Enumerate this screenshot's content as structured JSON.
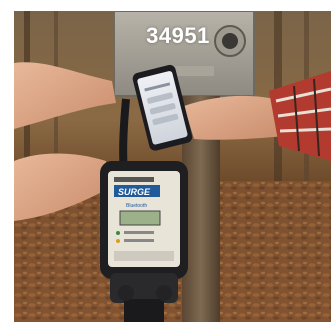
{
  "product_photo": {
    "overlay_number": "34951",
    "description_icon": "surge-protector-photo"
  },
  "device": {
    "brand_text": "SURGE",
    "bluetooth_text": "Bluetooth"
  },
  "colors": {
    "frame_border": "#6b4e2e",
    "overlay_text": "#ffffff",
    "device_body": "#1f1f21",
    "device_label": "#e8e4d8",
    "phone_screen": "#dfe3ea",
    "leaves": "#8a5a32"
  }
}
